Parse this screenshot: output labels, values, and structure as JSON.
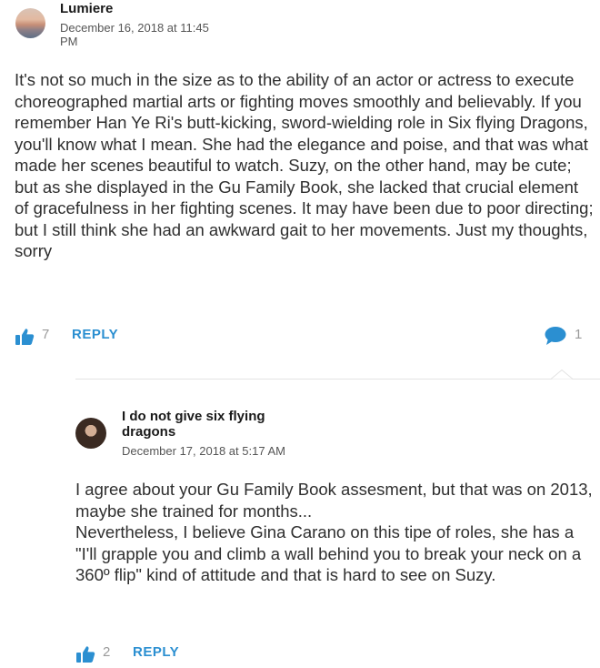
{
  "comment": {
    "author": "Lumiere",
    "timestamp": "December 16, 2018 at 11:45 PM",
    "text": "It's not so much in the size as to the ability of an actor or actress to execute choreographed martial arts or fighting moves smoothly and believably. If you remember Han Ye Ri's butt-kicking, sword-wielding role in Six flying Dragons, you'll know what I mean. She had the elegance and poise, and that was what made her scenes beautiful to watch. Suzy, on the other hand, may be cute; but as she displayed in the Gu Family Book, she lacked that crucial element of gracefulness in her fighting scenes. It may have been due to poor directing; but I still think she had an awkward gait to her movements. Just my thoughts, sorry",
    "likes": "7",
    "reply_label": "REPLY",
    "reply_count": "1",
    "avatar_icon": "sunset-avatar"
  },
  "reply": {
    "author": "I do not give six flying dragons",
    "timestamp": "December 17, 2018 at 5:17 AM",
    "text": "I agree about your Gu Family Book assesment, but that was on 2013, maybe she trained for months...\nNevertheless, I believe Gina Carano on this tipe of roles, she has a \"I'll grapple you and climb a wall behind you to break your neck on a 360º flip\" kind of attitude and that is hard to see on Suzy.",
    "likes": "2",
    "reply_label": "REPLY",
    "avatar_icon": "person-avatar"
  },
  "colors": {
    "accent": "#2b8fd1",
    "count": "#9a9a9a",
    "text": "#2f2f2f"
  }
}
